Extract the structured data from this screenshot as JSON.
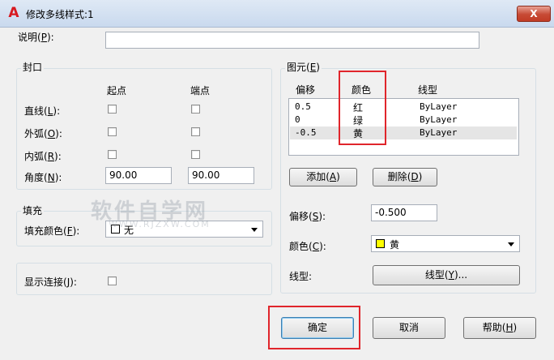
{
  "window": {
    "title": "修改多线样式:1",
    "close_label": "X"
  },
  "description": {
    "label": "说明",
    "hotkey": "P",
    "value": ""
  },
  "caps": {
    "title": "封口",
    "col_start": "起点",
    "col_end": "端点",
    "rows": [
      {
        "label": "直线",
        "hotkey": "L"
      },
      {
        "label": "外弧",
        "hotkey": "O"
      },
      {
        "label": "内弧",
        "hotkey": "R"
      }
    ],
    "angle": {
      "label": "角度",
      "hotkey": "N",
      "start": "90.00",
      "end": "90.00"
    }
  },
  "fill": {
    "title": "填充",
    "label": "填充颜色",
    "hotkey": "F",
    "value": "无"
  },
  "joints": {
    "label": "显示连接",
    "hotkey": "J"
  },
  "elements": {
    "title": "图元",
    "hotkey": "E",
    "headers": {
      "offset": "偏移",
      "color": "颜色",
      "linetype": "线型"
    },
    "rows": [
      {
        "offset": "0.5",
        "color": "红",
        "linetype": "ByLayer"
      },
      {
        "offset": "0",
        "color": "绿",
        "linetype": "ByLayer"
      },
      {
        "offset": "-0.5",
        "color": "黄",
        "linetype": "ByLayer"
      }
    ],
    "add_label": "添加",
    "add_hotkey": "A",
    "delete_label": "删除",
    "delete_hotkey": "D",
    "offset_label": "偏移",
    "offset_hotkey": "S",
    "offset_value": "-0.500",
    "color_label": "颜色",
    "color_hotkey": "C",
    "color_value": "黄",
    "color_swatch": "#ffff00",
    "linetype_label": "线型:",
    "linetype_button": "线型",
    "linetype_button_hotkey": "Y"
  },
  "buttons": {
    "ok": "确定",
    "cancel": "取消",
    "help": "帮助",
    "help_hotkey": "H"
  },
  "watermark": {
    "main": "软件自学网",
    "sub": "WWW.RJZXW.COM"
  },
  "colors": {
    "highlight_box": "#e0252b",
    "title_gradient_top": "#dfe9f5"
  }
}
